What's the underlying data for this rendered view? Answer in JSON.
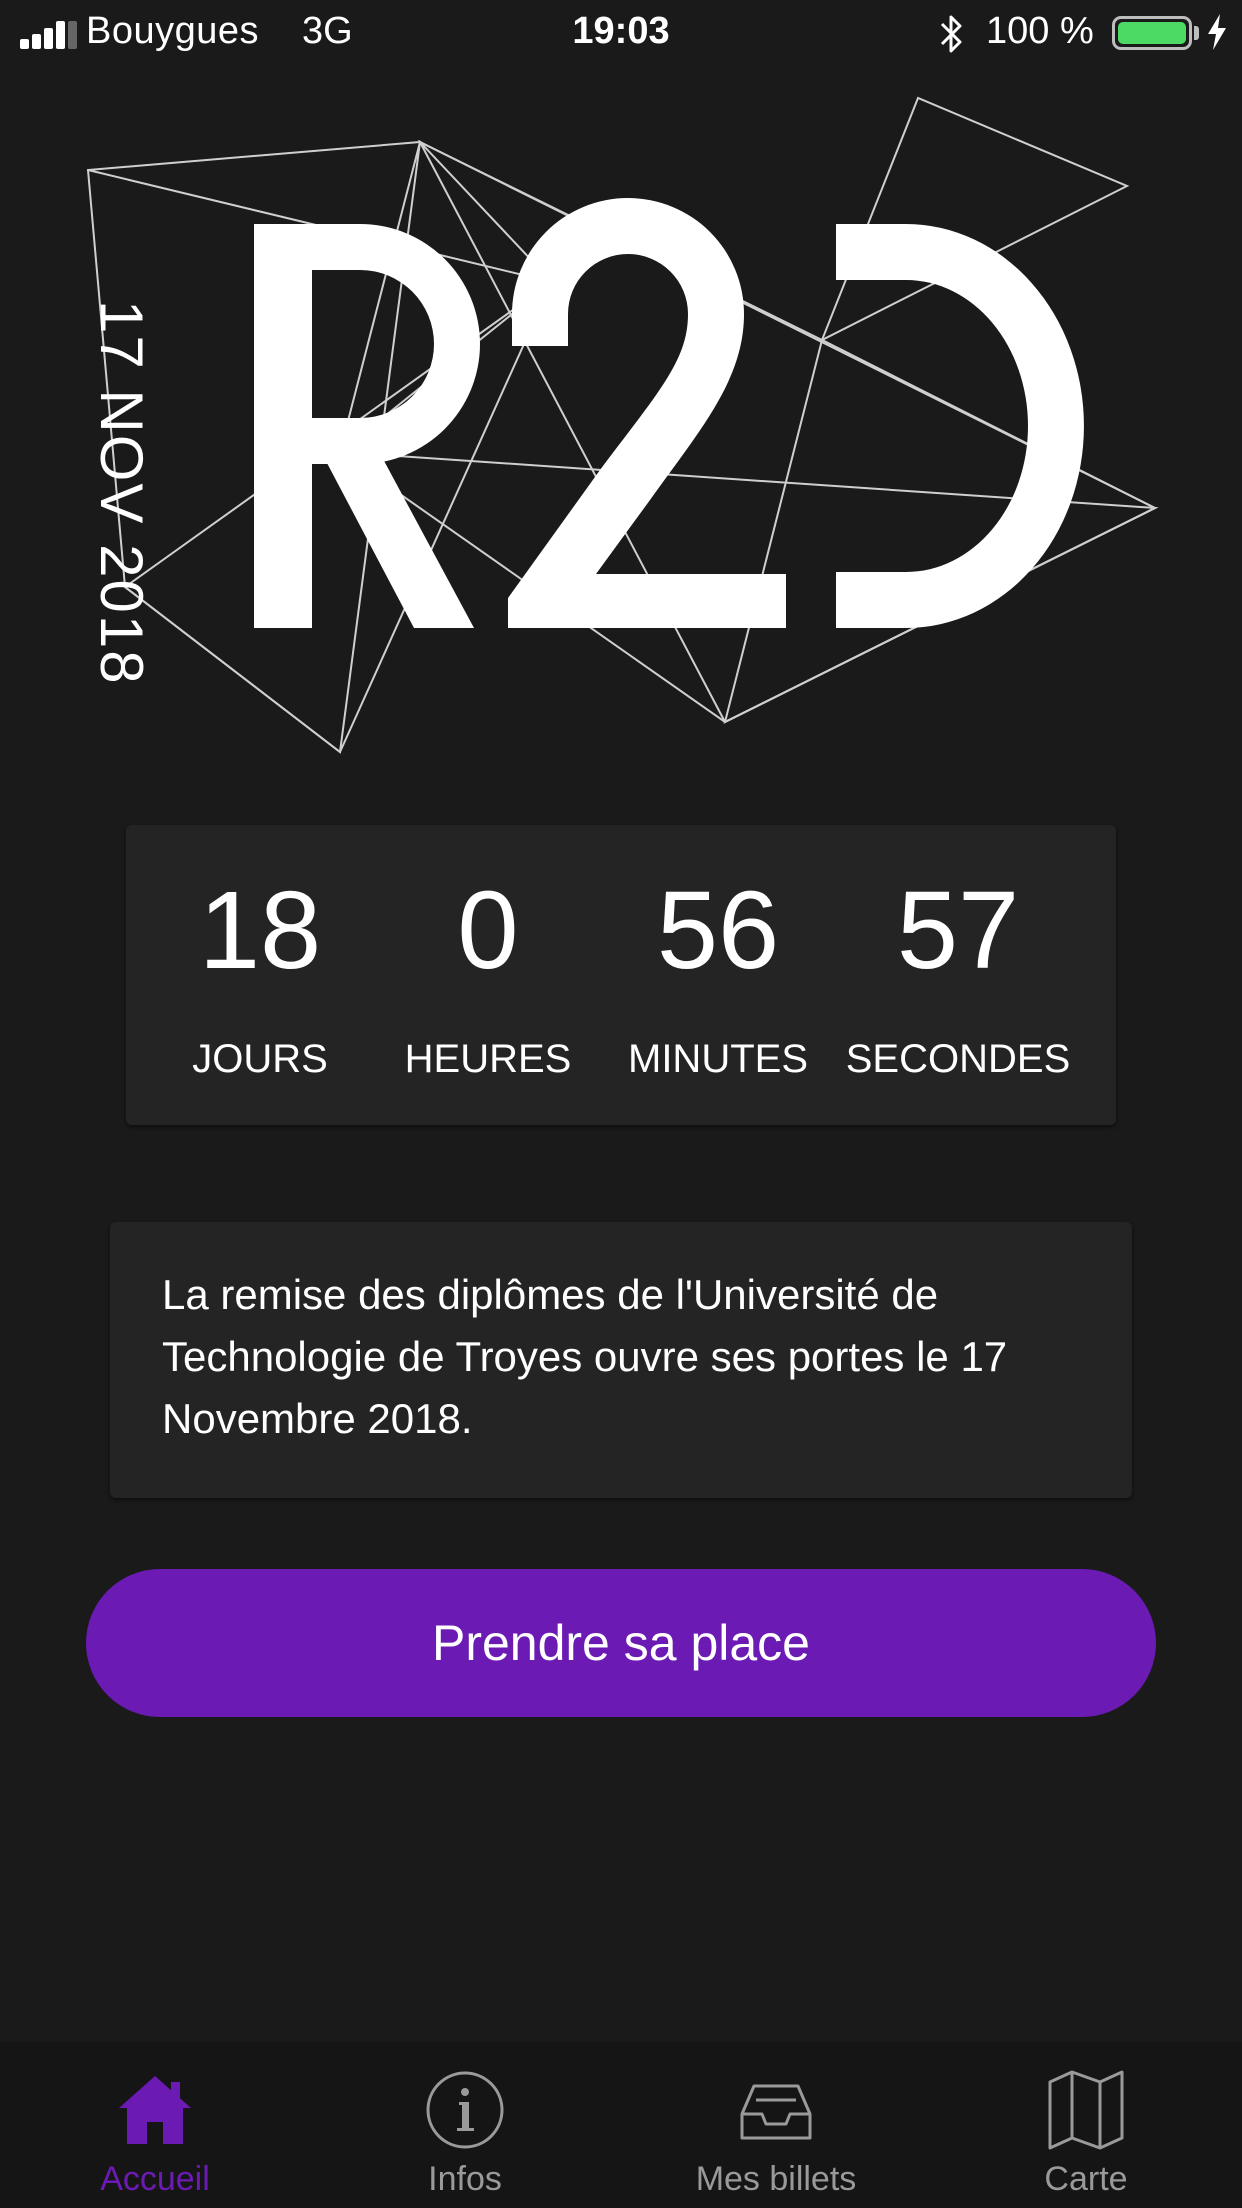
{
  "status_bar": {
    "carrier": "Bouygues",
    "network": "3G",
    "time": "19:03",
    "battery": "100 %",
    "icons": [
      "signal-icon",
      "bluetooth-icon",
      "battery-icon",
      "charging-icon"
    ]
  },
  "logo": {
    "date": "17 NOV 2018",
    "wordmark": "R2D"
  },
  "countdown": {
    "items": [
      {
        "value": "18",
        "label": "JOURS"
      },
      {
        "value": "0",
        "label": "HEURES"
      },
      {
        "value": "56",
        "label": "MINUTES"
      },
      {
        "value": "57",
        "label": "SECONDES"
      }
    ]
  },
  "info": {
    "text": "La remise des diplômes de l'Université de Technologie de Troyes ouvre ses portes le 17 Novembre 2018."
  },
  "cta": {
    "label": "Prendre sa place"
  },
  "tabs": [
    {
      "label": "Accueil",
      "icon": "home-icon",
      "active": true
    },
    {
      "label": "Infos",
      "icon": "info-icon",
      "active": false
    },
    {
      "label": "Mes billets",
      "icon": "inbox-icon",
      "active": false
    },
    {
      "label": "Carte",
      "icon": "map-icon",
      "active": false
    }
  ],
  "colors": {
    "background": "#1a1a1a",
    "card": "#242424",
    "accent": "#6b1ab3",
    "battery": "#4cd964",
    "inactive_tab": "#9a9a9a"
  }
}
